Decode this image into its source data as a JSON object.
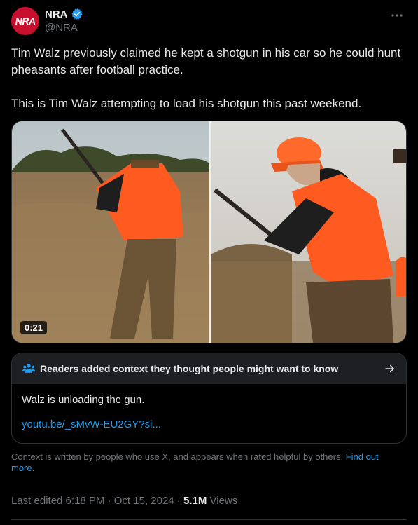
{
  "account": {
    "avatar_text": "NRA",
    "display_name": "NRA",
    "handle": "@NRA"
  },
  "icons": {
    "verified": "verified-badge-icon",
    "more": "more-options-icon",
    "people": "people-icon",
    "arrow": "arrow-right-icon"
  },
  "colors": {
    "background": "#000000",
    "text": "#e7e9ea",
    "muted": "#71767b",
    "link": "#1d9bf0",
    "verified": "#1d9bf0",
    "avatar": "#c8102e",
    "vest": "#ff5a1f"
  },
  "tweet": {
    "paragraph_1": "Tim Walz previously claimed he kept a shotgun in his car so he could hunt pheasants after football practice.",
    "paragraph_2": "This is Tim Walz attempting to load his shotgun this past weekend."
  },
  "media": {
    "duration": "0:21"
  },
  "community_note": {
    "title": "Readers added context they thought people might want to know",
    "text": "Walz is unloading the gun.",
    "link": "youtu.be/_sMvW-EU2GY?si..."
  },
  "context": {
    "text": "Context is written by people who use X, and appears when rated helpful by others.",
    "link": "Find out more."
  },
  "meta": {
    "edited": "Last edited 6:18 PM · Oct 15, 2024 · ",
    "views_count": "5.1M",
    "views_label": " Views"
  }
}
